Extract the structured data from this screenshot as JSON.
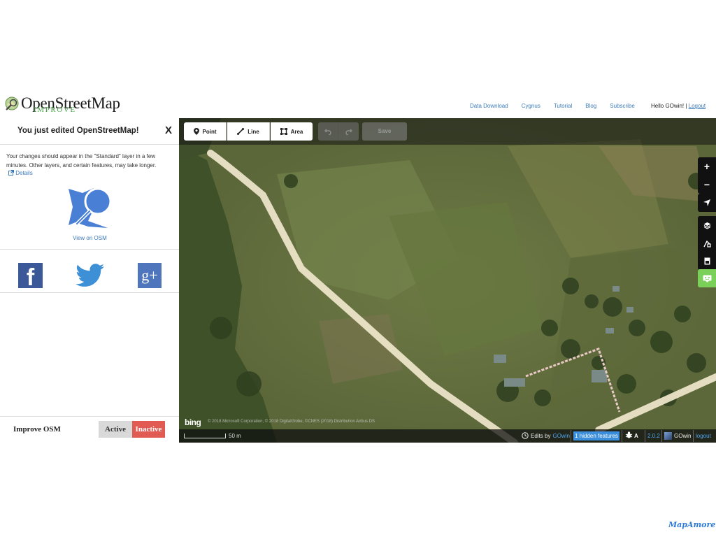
{
  "header": {
    "logo_title": "OpenStreetMap",
    "logo_subtitle": "IMPROVE",
    "nav": [
      "Data Download",
      "Cygnus",
      "Tutorial",
      "Blog",
      "Subscribe"
    ],
    "greeting": "Hello GOwin! | ",
    "logout": "Logout"
  },
  "panel": {
    "title": "You just edited OpenStreetMap!",
    "close": "X",
    "message": "Your changes should appear in the \"Standard\" layer in a few minutes. Other layers, and certain features, may take longer.",
    "details_link": "Details",
    "view_on_osm": "View on OSM",
    "social": [
      "facebook-icon",
      "twitter-icon",
      "google-plus-icon"
    ],
    "facebook_glyph": "f",
    "googleplus_glyph": "g+"
  },
  "improve": {
    "label": "Improve OSM",
    "active": "Active",
    "inactive": "Inactive"
  },
  "toolbar": {
    "point": "Point",
    "line": "Line",
    "area": "Area",
    "save": "Save"
  },
  "map_controls": [
    "zoom-in-icon",
    "zoom-out-icon",
    "geolocate-icon",
    "layers-icon",
    "map-data-icon",
    "issues-icon",
    "help-icon"
  ],
  "footer": {
    "scale": "50 m",
    "bing": "bing",
    "attribution": "© 2018 Microsoft Corporation, © 2018 DigitalGlobe, ©CNES (2018) Distribution Airbus DS",
    "edits_by": "Edits by",
    "editor": "GOwin",
    "hidden_features": "1 hidden features",
    "a11y": "A",
    "version": "2.0.2",
    "user": "GOwin",
    "logout": "logout"
  },
  "brand": "MapAmore",
  "colors": {
    "link": "#3d7ab8",
    "inactive": "#e15b52",
    "help": "#7bd05a",
    "hidden": "#3a8edb"
  }
}
